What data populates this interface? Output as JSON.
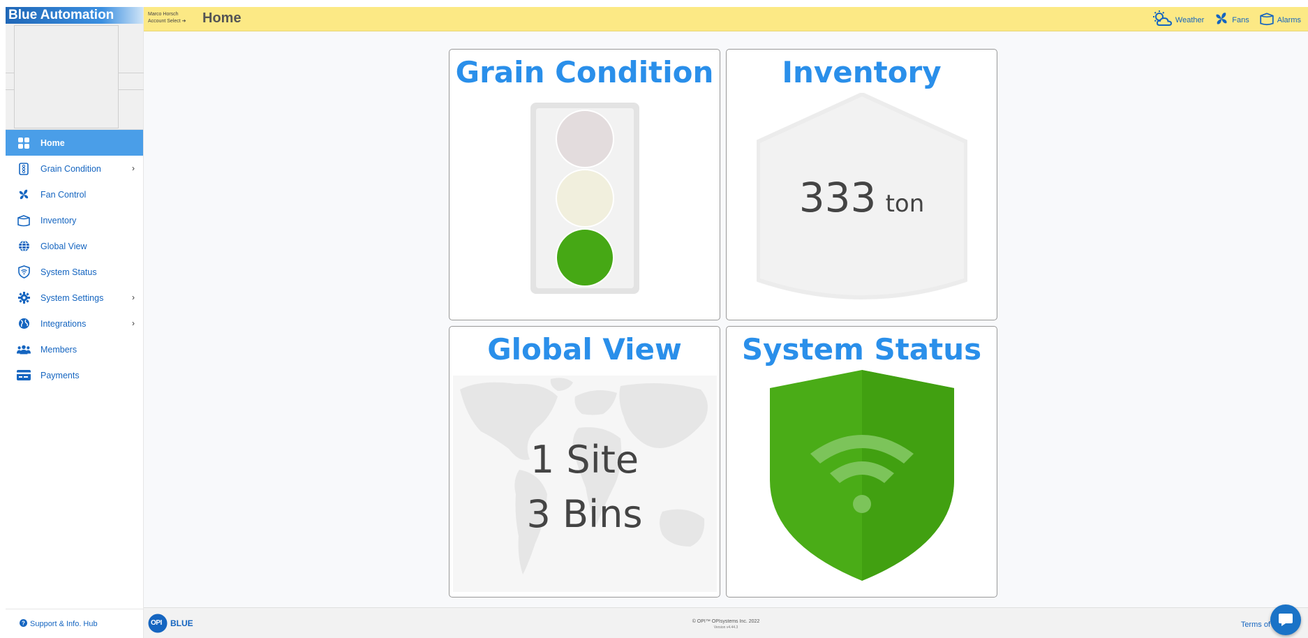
{
  "app": {
    "brand": "Blue Automation"
  },
  "account": {
    "user": "Marco Horsch",
    "select_label": "Account Select ➔"
  },
  "header": {
    "title": "Home",
    "links": [
      {
        "label": "Weather",
        "icon": "weather-icon"
      },
      {
        "label": "Fans",
        "icon": "fan-icon"
      },
      {
        "label": "Alarms",
        "icon": "alarm-bin-icon"
      }
    ]
  },
  "sidebar": {
    "items": [
      {
        "label": "Home",
        "icon": "grid-icon",
        "active": true
      },
      {
        "label": "Grain Condition",
        "icon": "traffic-light-icon",
        "has_submenu": true
      },
      {
        "label": "Fan Control",
        "icon": "fan-icon"
      },
      {
        "label": "Inventory",
        "icon": "bin-icon"
      },
      {
        "label": "Global View",
        "icon": "globe-icon"
      },
      {
        "label": "System Status",
        "icon": "shield-wifi-icon"
      },
      {
        "label": "System Settings",
        "icon": "gear-icon",
        "has_submenu": true
      },
      {
        "label": "Integrations",
        "icon": "earth-icon",
        "has_submenu": true
      },
      {
        "label": "Members",
        "icon": "members-icon"
      },
      {
        "label": "Payments",
        "icon": "payment-card-icon"
      }
    ],
    "support_label": "Support & Info. Hub"
  },
  "cards": {
    "grain_condition": {
      "title": "Grain Condition",
      "status": "green"
    },
    "inventory": {
      "title": "Inventory",
      "value": "333",
      "unit": "ton"
    },
    "global_view": {
      "title": "Global View",
      "sites": "1 Site",
      "bins": "3 Bins"
    },
    "system_status": {
      "title": "System Status",
      "status": "ok"
    }
  },
  "footer": {
    "logo_text": "OPI",
    "logo_sub": "BLUE",
    "copyright": "© OPI™ OPIsystems Inc. 2022",
    "version": "Version v4.44.3",
    "terms": "Terms of"
  },
  "colors": {
    "brand_blue": "#2a8fea",
    "header_yellow": "#fce985",
    "active_nav": "#4a9ee8",
    "status_green": "#46a815"
  }
}
